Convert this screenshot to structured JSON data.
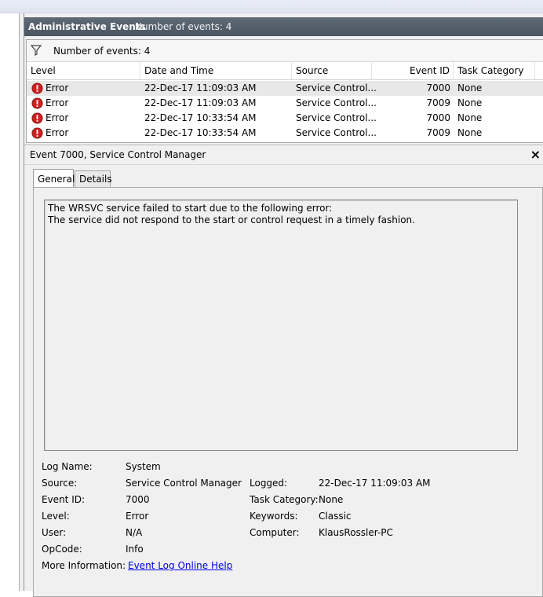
{
  "header": {
    "title": "Administrative Events",
    "count": "Number of events: 4"
  },
  "filter": {
    "text": "Number of events: 4"
  },
  "columns": [
    "Level",
    "Date and Time",
    "Source",
    "Event ID",
    "Task Category"
  ],
  "events": [
    {
      "level": "Error",
      "datetime": "22-Dec-17 11:09:03 AM",
      "source": "Service Control...",
      "event_id": "7000",
      "category": "None"
    },
    {
      "level": "Error",
      "datetime": "22-Dec-17 11:09:03 AM",
      "source": "Service Control...",
      "event_id": "7009",
      "category": "None"
    },
    {
      "level": "Error",
      "datetime": "22-Dec-17 10:33:54 AM",
      "source": "Service Control...",
      "event_id": "7000",
      "category": "None"
    },
    {
      "level": "Error",
      "datetime": "22-Dec-17 10:33:54 AM",
      "source": "Service Control...",
      "event_id": "7009",
      "category": "None"
    }
  ],
  "detail": {
    "title": "Event 7000, Service Control Manager",
    "close": "×",
    "tabs": [
      "General",
      "Details"
    ],
    "description": [
      "The WRSVC service failed to start due to the following error:",
      "The service did not respond to the start or control request in a timely fashion."
    ],
    "props": {
      "log_name_label": "Log Name:",
      "log_name": "System",
      "source_label": "Source:",
      "source": "Service Control Manager",
      "logged_label": "Logged:",
      "logged": "22-Dec-17 11:09:03 AM",
      "event_id_label": "Event ID:",
      "event_id": "7000",
      "task_category_label": "Task Category:",
      "task_category": "None",
      "level_label": "Level:",
      "level": "Error",
      "keywords_label": "Keywords:",
      "keywords": "Classic",
      "user_label": "User:",
      "user": "N/A",
      "computer_label": "Computer:",
      "computer": "KlausRossler-PC",
      "opcode_label": "OpCode:",
      "opcode": "Info",
      "more_info_label": "More Information:",
      "more_info_link": "Event Log Online Help"
    }
  },
  "colors": {
    "header_bg": "#4b5562",
    "error_red": "#d01f1f",
    "link": "#0000ee"
  },
  "icons": {
    "filter": "filter-funnel-icon",
    "error": "error-circle-icon"
  }
}
